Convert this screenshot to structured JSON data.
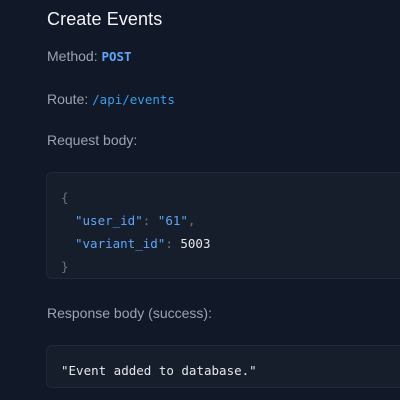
{
  "endpoint": {
    "title": "Create Events",
    "method_label": "Method:",
    "method_value": "POST",
    "route_label": "Route:",
    "route_value": "/api/events",
    "request_body_label": "Request body:",
    "response_body_label": "Response body (success):"
  },
  "request_body": {
    "open_brace": "{",
    "close_brace": "}",
    "fields": [
      {
        "key": "\"user_id\"",
        "sep": ": ",
        "value": "\"61\"",
        "trail": ","
      },
      {
        "key": "\"variant_id\"",
        "sep": ": ",
        "value": "5003",
        "trail": ""
      }
    ]
  },
  "response_body": {
    "text": "\"Event added to database.\""
  },
  "colors": {
    "background": "#111827",
    "code_background": "#161d2b",
    "accent_blue": "#60a5fa",
    "title_text": "#f3f4f6",
    "muted_text": "#9ca3af"
  }
}
